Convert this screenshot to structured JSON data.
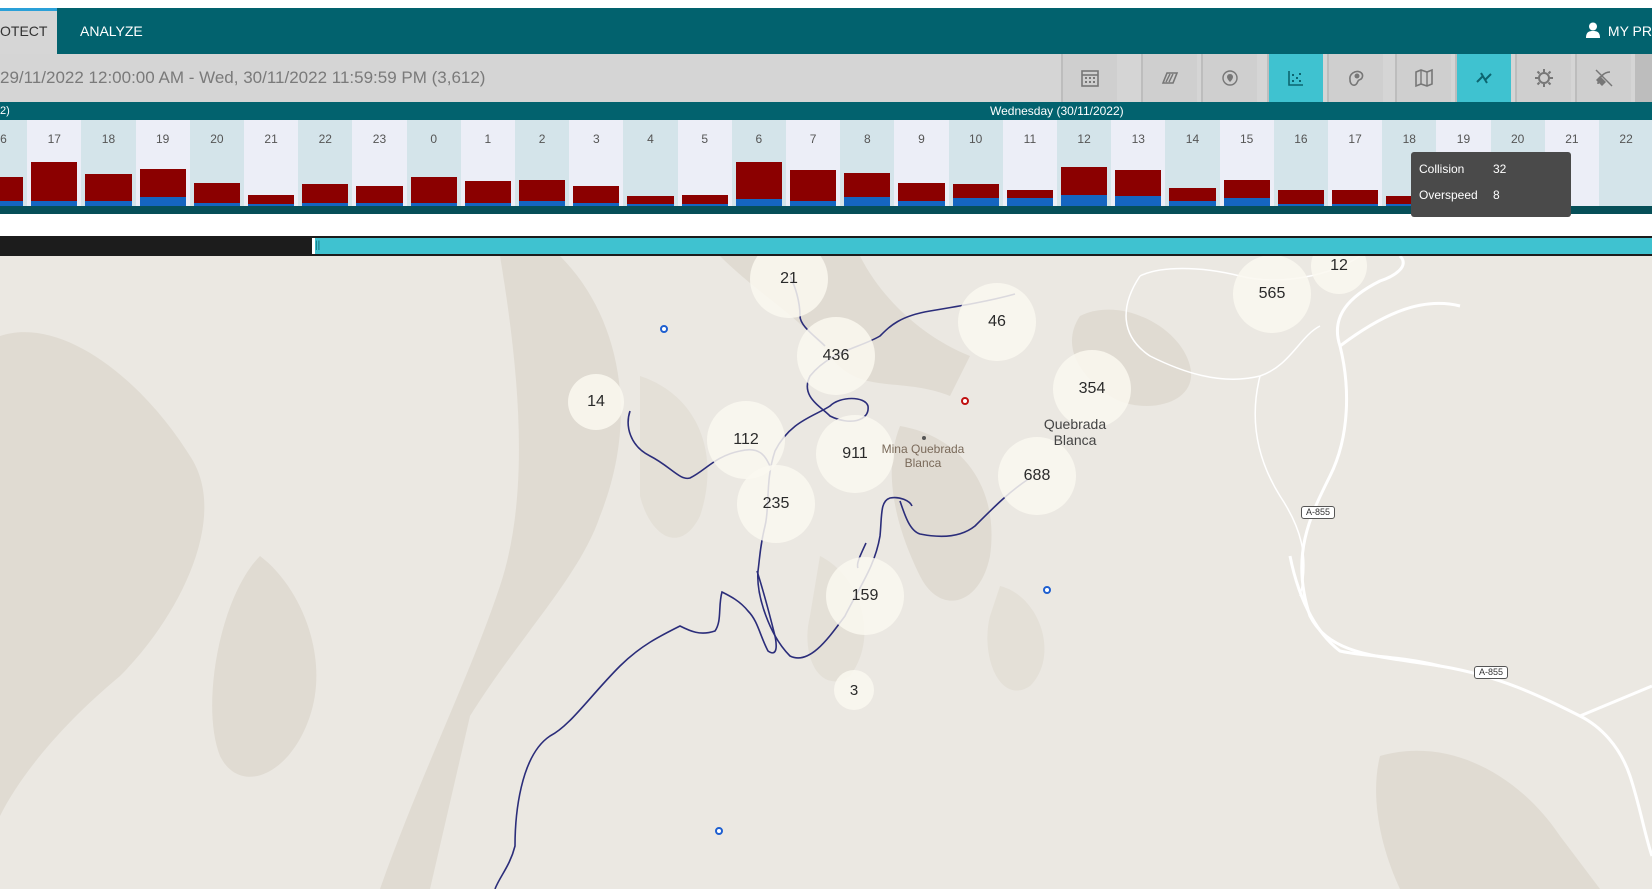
{
  "nav": {
    "tabs": [
      {
        "label": "OTECT"
      },
      {
        "label": "ANALYZE"
      }
    ],
    "profile_label": "MY PR"
  },
  "range": {
    "text": "29/11/2022 12:00:00 AM - Wed, 30/11/2022 11:59:59 PM (3,612)"
  },
  "toolbar": {
    "buttons": [
      {
        "icon": "calendar-icon",
        "active": false
      },
      {
        "icon": "layers-icon",
        "active": false
      },
      {
        "icon": "location-pin-icon",
        "active": false
      },
      {
        "icon": "scatter-chart-icon",
        "active": true
      },
      {
        "icon": "heatmap-icon",
        "active": false
      },
      {
        "icon": "map-icon",
        "active": false
      },
      {
        "icon": "route-icon",
        "active": true
      },
      {
        "icon": "settings-icon",
        "active": false
      },
      {
        "icon": "satellite-icon",
        "active": false
      }
    ]
  },
  "daystrip": {
    "left_label": "2)",
    "day_label": "Wednesday (30/11/2022)"
  },
  "hour_chart": {
    "hours": [
      "16",
      "17",
      "18",
      "19",
      "20",
      "21",
      "22",
      "23",
      "0",
      "1",
      "2",
      "3",
      "4",
      "5",
      "6",
      "7",
      "8",
      "9",
      "10",
      "11",
      "12",
      "13",
      "14",
      "15",
      "16",
      "17",
      "18",
      "19",
      "20",
      "21",
      "22"
    ],
    "collision": [
      0.55,
      0.85,
      0.62,
      0.72,
      0.45,
      0.22,
      0.42,
      0.38,
      0.55,
      0.48,
      0.5,
      0.38,
      0.2,
      0.22,
      0.85,
      0.7,
      0.63,
      0.45,
      0.42,
      0.3,
      0.75,
      0.7,
      0.35,
      0.5,
      0.3,
      0.3,
      0.2,
      0,
      0,
      0,
      0
    ],
    "overspeed": [
      0.1,
      0.1,
      0.1,
      0.18,
      0.05,
      0.02,
      0.05,
      0.05,
      0.05,
      0.05,
      0.1,
      0.05,
      0.02,
      0.02,
      0.14,
      0.1,
      0.18,
      0.1,
      0.16,
      0.15,
      0.22,
      0.2,
      0.1,
      0.15,
      0.04,
      0.04,
      0.02,
      0,
      0,
      0,
      0
    ],
    "colors": {
      "collision": "#8b0000",
      "overspeed": "#1565c0"
    }
  },
  "tooltip": {
    "rows": [
      {
        "label": "Collision",
        "value": "32"
      },
      {
        "label": "Overspeed",
        "value": "8"
      }
    ]
  },
  "scrubber": {
    "handle": "||"
  },
  "map": {
    "clusters": [
      {
        "label": "21"
      },
      {
        "label": "565"
      },
      {
        "label": "12"
      },
      {
        "label": "46"
      },
      {
        "label": "436"
      },
      {
        "label": "14"
      },
      {
        "label": "354"
      },
      {
        "label": "112"
      },
      {
        "label": "911"
      },
      {
        "label": "688"
      },
      {
        "label": "235"
      },
      {
        "label": "159"
      },
      {
        "label": "3"
      }
    ],
    "places": [
      {
        "label": "Quebrada\nBlanca"
      },
      {
        "label": "Mina Quebrada\nBlanca"
      }
    ],
    "road_shields": [
      "A-855",
      "A-855"
    ]
  }
}
